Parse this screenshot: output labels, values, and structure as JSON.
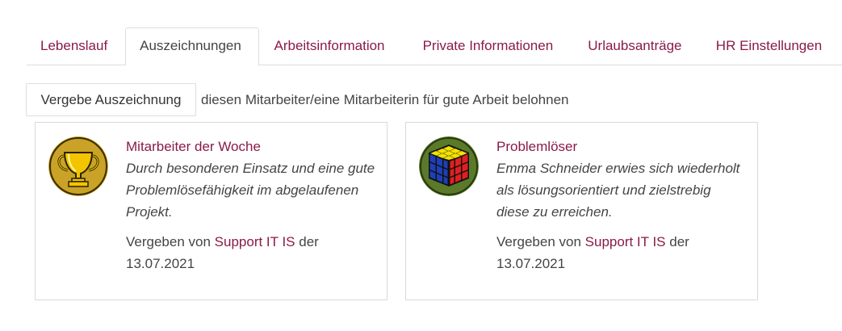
{
  "tabs": [
    {
      "label": "Lebenslauf",
      "active": false
    },
    {
      "label": "Auszeichnungen",
      "active": true
    },
    {
      "label": "Arbeitsinformation",
      "active": false
    },
    {
      "label": "Private Informationen",
      "active": false
    },
    {
      "label": "Urlaubsanträge",
      "active": false
    },
    {
      "label": "HR Einstellungen",
      "active": false
    }
  ],
  "award_toolbar": {
    "button_label": "Vergebe Auszeichnung",
    "hint": "diesen Mitarbeiter/eine Mitarbeiterin für gute Arbeit belohnen"
  },
  "awards": [
    {
      "icon": "trophy-icon",
      "title": "Mitarbeiter der Woche",
      "description": "Durch besonderen Einsatz und eine gute Problemlösefähigkeit im abgelaufenen Projekt.",
      "given_by_prefix": "Vergeben von",
      "given_by": "Support IT IS",
      "date_prefix": "der",
      "date": "13.07.2021"
    },
    {
      "icon": "rubiks-cube-icon",
      "title": "Problemlöser",
      "description": "Emma Schneider erwies sich wiederholt als lösungsorientiert und zielstrebig diese zu erreichen.",
      "given_by_prefix": "Vergeben von",
      "given_by": "Support IT IS",
      "date_prefix": "der",
      "date": "13.07.2021"
    }
  ],
  "colors": {
    "link": "#8a1a4a",
    "trophy_bg": "#c9a227",
    "cube_bg": "#5a7a2a"
  }
}
